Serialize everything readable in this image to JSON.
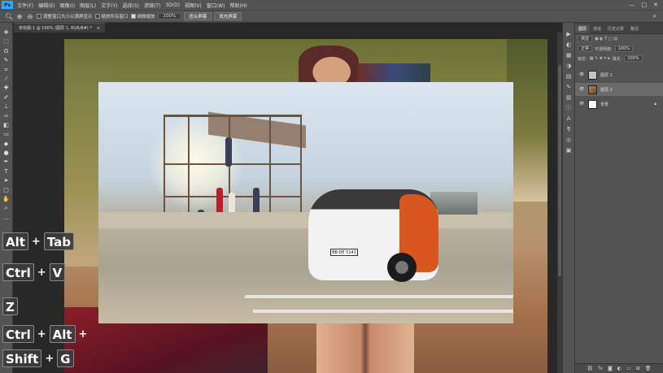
{
  "app": {
    "logo": "Ps"
  },
  "menu": [
    "文件(F)",
    "编辑(E)",
    "图像(I)",
    "图层(L)",
    "文字(Y)",
    "选择(S)",
    "滤镜(T)",
    "3D(D)",
    "视图(V)",
    "窗口(W)",
    "帮助(H)"
  ],
  "window_controls": {
    "minimize": "—",
    "maximize": "□",
    "close": "✕"
  },
  "options": {
    "resize_windows": "调整窗口大小以满屏显示",
    "zoom_all": "缩放所有窗口",
    "scrubby_zoom": "细微缩放",
    "zoom_value": "100%",
    "fit_screen": "适合屏幕",
    "fill_screen": "填充屏幕"
  },
  "document": {
    "tab_title": "未标题-1 @ 100% (图层 1, RGB/8#) *",
    "close": "×"
  },
  "car_photo": {
    "plate": "BB·DE 5141"
  },
  "shortcuts": {
    "row1": [
      "Alt",
      "Tab"
    ],
    "row2": [
      "Ctrl",
      "V"
    ],
    "row3": [
      "Z"
    ],
    "row4": [
      "Ctrl",
      "Alt"
    ],
    "row5": [
      "Shift",
      "G"
    ],
    "plus": "+"
  },
  "panel": {
    "tabs": [
      "图层",
      "通道",
      "历史记录",
      "路径"
    ],
    "filter_kind": "类型",
    "blend_mode": "正常",
    "opacity_label": "不透明度:",
    "opacity": "100%",
    "lock_label": "锁定:",
    "fill_label": "填充:",
    "fill": "100%",
    "layers": [
      {
        "name": "图层 1"
      },
      {
        "name": "图层 2"
      },
      {
        "name": "背景"
      }
    ]
  },
  "colors": {
    "accent": "#31a8ff",
    "panel": "#535353",
    "dark": "#282828"
  }
}
